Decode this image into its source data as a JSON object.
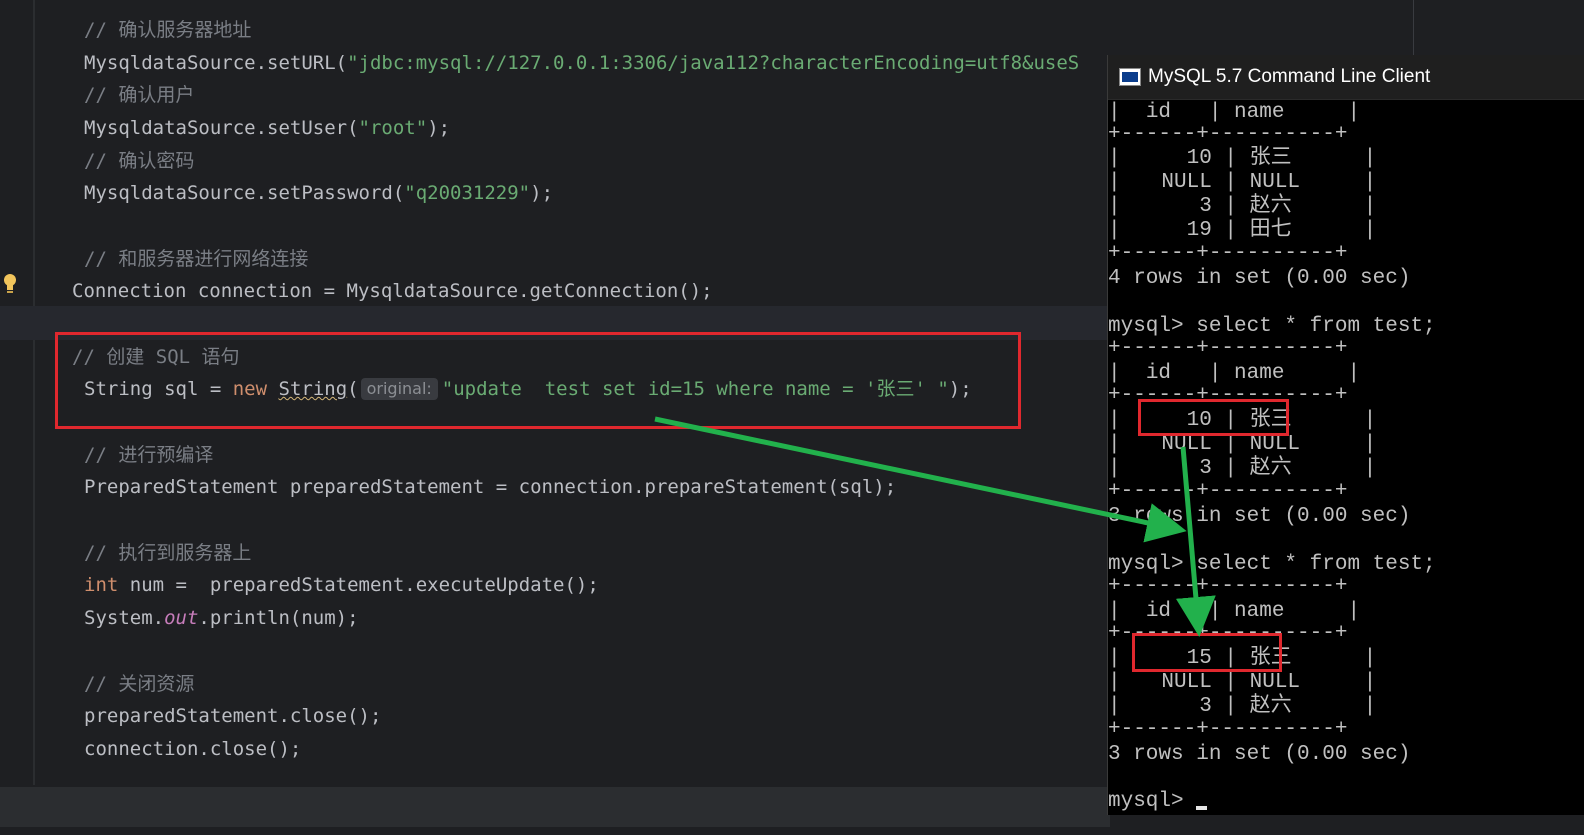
{
  "editor": {
    "lines": [
      {
        "id": "c1",
        "text": "// 确认服务器地址"
      },
      {
        "id": "l1a",
        "text": "MysqldataSource.setURL("
      },
      {
        "id": "l1b",
        "text": "\"jdbc:mysql://127.0.0.1:3306/java112?characterEncoding=utf8&useS"
      },
      {
        "id": "c2",
        "text": "// 确认用户"
      },
      {
        "id": "l2a",
        "text": "MysqldataSource.setUser("
      },
      {
        "id": "l2b",
        "text": "\"root\""
      },
      {
        "id": "l2c",
        "text": ");"
      },
      {
        "id": "c3",
        "text": "// 确认密码"
      },
      {
        "id": "l3a",
        "text": "MysqldataSource.setPassword("
      },
      {
        "id": "l3b",
        "text": "\"q20031229\""
      },
      {
        "id": "l3c",
        "text": ");"
      },
      {
        "id": "c4",
        "text": "// 和服务器进行网络连接"
      },
      {
        "id": "l4",
        "text": "Connection connection = MysqldataSource.getConnection();"
      },
      {
        "id": "c5",
        "text": "// 创建 SQL 语句"
      },
      {
        "id": "l5a",
        "text": "String sql = "
      },
      {
        "id": "l5b",
        "text": "new"
      },
      {
        "id": "l5c",
        "text": " "
      },
      {
        "id": "l5d",
        "text": "String"
      },
      {
        "id": "l5e",
        "text": "("
      },
      {
        "id": "l5hint",
        "text": "original:"
      },
      {
        "id": "l5f",
        "text": "\"update  test set id=15 where name = '张三' \""
      },
      {
        "id": "l5g",
        "text": ");"
      },
      {
        "id": "c6",
        "text": "// 进行预编译"
      },
      {
        "id": "l6",
        "text": "PreparedStatement preparedStatement = connection.prepareStatement(sql);"
      },
      {
        "id": "c7",
        "text": "// 执行到服务器上"
      },
      {
        "id": "l7a",
        "text": "int"
      },
      {
        "id": "l7b",
        "text": " num =  preparedStatement.executeUpdate();"
      },
      {
        "id": "l8a",
        "text": "System."
      },
      {
        "id": "l8b",
        "text": "out"
      },
      {
        "id": "l8c",
        "text": ".println(num);"
      },
      {
        "id": "c8",
        "text": "// 关闭资源"
      },
      {
        "id": "l9",
        "text": "preparedStatement.close();"
      },
      {
        "id": "l10",
        "text": "connection.close();"
      }
    ]
  },
  "mysql": {
    "title": "MySQL 5.7 Command Line Client",
    "table1": {
      "header": "| id   | name     |",
      "border": "+------+----------+",
      "rows": [
        {
          "id": "10",
          "name": "张三"
        },
        {
          "id": "NULL",
          "name": "NULL"
        },
        {
          "id": "3",
          "name": "赵六"
        },
        {
          "id": "19",
          "name": "田七"
        }
      ],
      "footer": "4 rows in set (0.00 sec)"
    },
    "query2": "mysql> select * from test;",
    "table2": {
      "rows": [
        {
          "id": "10",
          "name": "张三"
        },
        {
          "id": "NULL",
          "name": "NULL"
        },
        {
          "id": "3",
          "name": "赵六"
        }
      ],
      "footer": "3 rows in set (0.00 sec)"
    },
    "query3": "mysql> select * from test;",
    "table3": {
      "rows": [
        {
          "id": "15",
          "name": "张三"
        },
        {
          "id": "NULL",
          "name": "NULL"
        },
        {
          "id": "3",
          "name": "赵六"
        }
      ],
      "footer": "3 rows in set (0.00 sec)"
    },
    "prompt": "mysql> ",
    "col_id": "id",
    "col_name": "name"
  },
  "colors": {
    "highlight_box": "#e0282e",
    "arrow": "#22b14c",
    "string": "#6aab73",
    "keyword": "#cf8e6d",
    "comment": "#7a7e85"
  }
}
